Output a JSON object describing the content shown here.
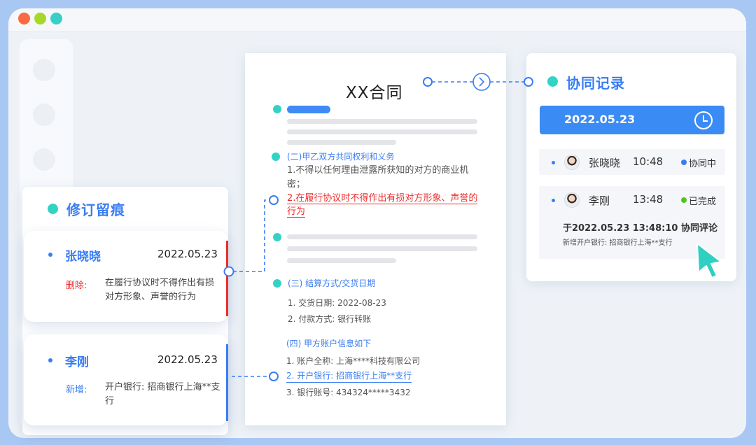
{
  "window": {
    "controls": [
      "close",
      "minimize",
      "maximize"
    ]
  },
  "document": {
    "title": "XX合同",
    "section2_heading": "(二)甲乙双方共同权利和义务",
    "section2_item1_line1": "1.不得以任何理由泄露所获知的对方的商业机",
    "section2_item1_line2": "密；",
    "section2_item2_line1": "2.在履行协议时不得作出有损对方形象、声誉的",
    "section2_item2_line2": "行为",
    "section3_heading": "(三) 结算方式/交货日期",
    "section3_item1": "1. 交货日期: 2022-08-23",
    "section3_item2": "2. 付款方式: 银行转账",
    "section4_heading": "(四) 甲方账户信息如下",
    "section4_item1": "1. 账户全称: 上海****科技有限公司",
    "section4_item2": "2. 开户银行: 招商银行上海**支行",
    "section4_item3": "3. 银行账号: 434324*****3432"
  },
  "revision_panel": {
    "title": "修订留痕",
    "entries": [
      {
        "name": "张晓晓",
        "date": "2022.05.23",
        "tag": "删除:",
        "content": "在履行协议时不得作出有损对方形象、声誉的行为"
      },
      {
        "name": "李刚",
        "date": "2022.05.23",
        "tag": "新增:",
        "content": "开户银行: 招商银行上海**支行"
      }
    ]
  },
  "collab_panel": {
    "title": "协同记录",
    "date": "2022.05.23",
    "records": [
      {
        "name": "张晓晓",
        "time": "10:48",
        "status": "协同中"
      },
      {
        "name": "李刚",
        "time": "13:48",
        "status": "已完成",
        "note_title": "于2022.05.23  13:48:10 协同评论",
        "note_body": "新增开户银行: 招商银行上海**支行"
      }
    ]
  },
  "icons": [
    "clock-icon",
    "chevron-right-icon",
    "cursor-pointer-icon",
    "avatar-icon"
  ],
  "colors": {
    "accent_blue": "#3a7df2",
    "teal": "#33d3c4",
    "delete_red": "#ee2c2c",
    "status_active": "#3a7df2",
    "status_done": "#52c41a",
    "background": "#a9c7f3"
  }
}
